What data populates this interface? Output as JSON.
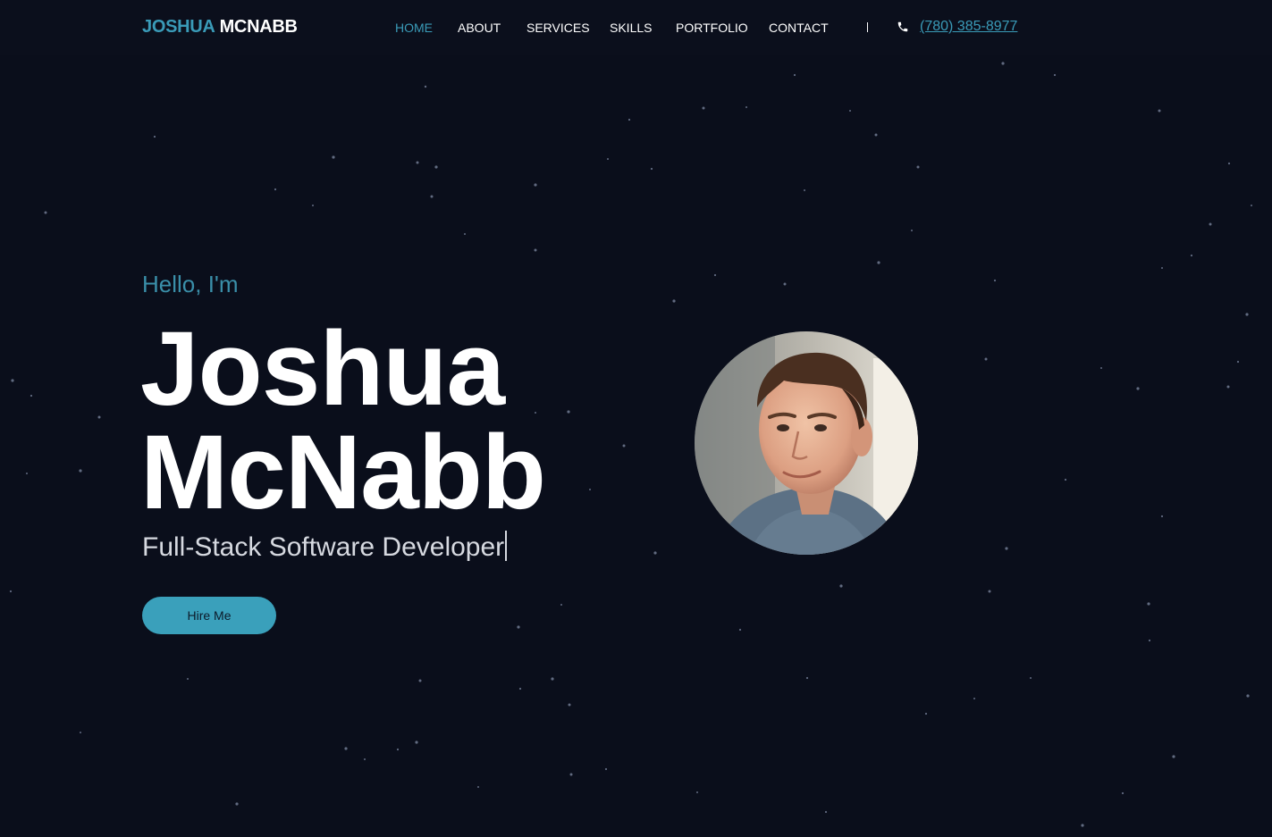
{
  "brand": {
    "first_name": "JOSHUA",
    "last_name": "MCNABB",
    "accent_color": "#3a9bb8"
  },
  "nav": {
    "items": [
      {
        "label": "HOME",
        "active": true
      },
      {
        "label": "ABOUT",
        "active": false
      },
      {
        "label": "SERVICES",
        "active": false
      },
      {
        "label": "SKILLS",
        "active": false
      },
      {
        "label": "PORTFOLIO",
        "active": false
      },
      {
        "label": "CONTACT",
        "active": false
      }
    ],
    "phone": "(780) 385-8977",
    "phone_icon": "phone-icon"
  },
  "hero": {
    "greeting": "Hello, I'm",
    "name_line1": "Joshua",
    "name_line2": "McNabb",
    "role": "Full-Stack Software Developer",
    "cta_label": "Hire Me",
    "avatar": "profile-photo"
  },
  "colors": {
    "background": "#0a0e1b",
    "accent": "#3a9bb8",
    "button": "#3aa0bb"
  }
}
